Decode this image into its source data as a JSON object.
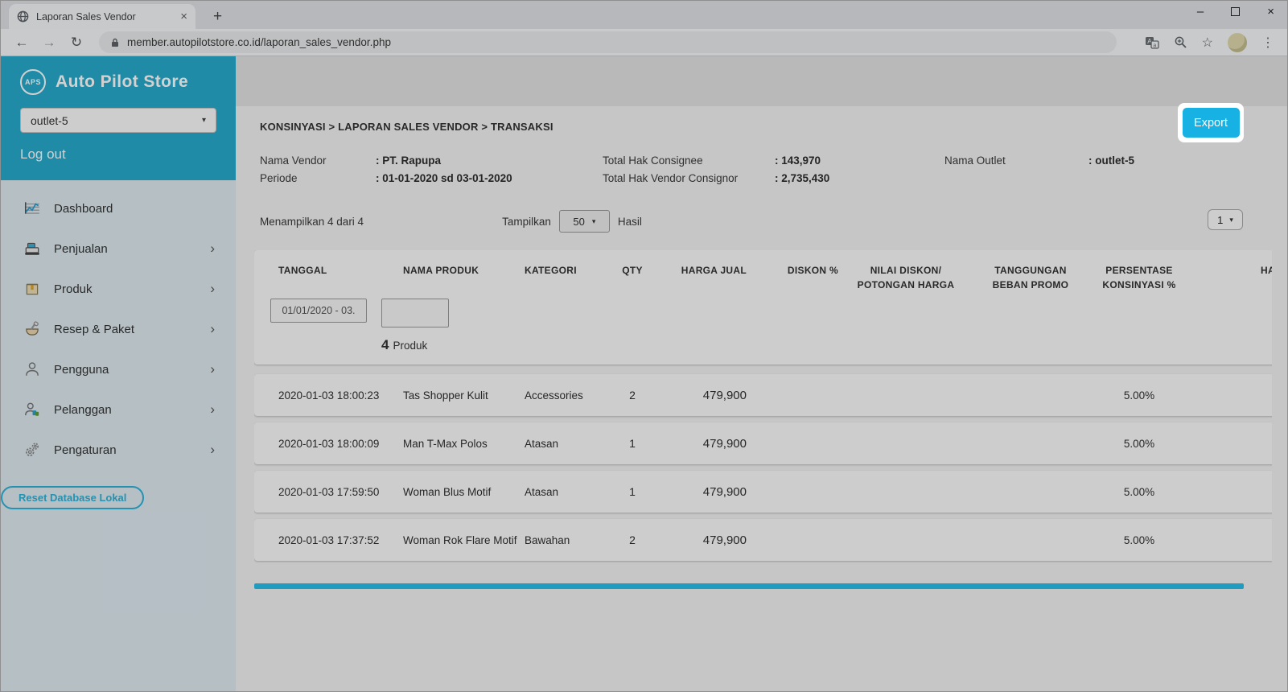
{
  "browser": {
    "tab_title": "Laporan Sales Vendor",
    "url": "member.autopilotstore.co.id/laporan_sales_vendor.php"
  },
  "icons": {
    "back": "←",
    "forward": "→",
    "reload": "↻",
    "star": "☆",
    "dots": "⋮",
    "new_tab": "+",
    "tab_close": "×",
    "minimize": "–",
    "close": "×",
    "caret_down": "▾",
    "chevron_right": "›"
  },
  "sidebar": {
    "logo_text": "APS",
    "brand": "Auto Pilot Store",
    "outlet_selector": "outlet-5",
    "logout_label": "Log out",
    "menu": [
      {
        "label": "Dashboard",
        "icon": "dashboard-icon",
        "has_submenu": false
      },
      {
        "label": "Penjualan",
        "icon": "sales-icon",
        "has_submenu": true
      },
      {
        "label": "Produk",
        "icon": "product-icon",
        "has_submenu": true
      },
      {
        "label": "Resep & Paket",
        "icon": "recipe-icon",
        "has_submenu": true
      },
      {
        "label": "Pengguna",
        "icon": "users-icon",
        "has_submenu": true
      },
      {
        "label": "Pelanggan",
        "icon": "customers-icon",
        "has_submenu": true
      },
      {
        "label": "Pengaturan",
        "icon": "settings-icon",
        "has_submenu": true
      }
    ],
    "reset_button": "Reset Database Lokal"
  },
  "main": {
    "breadcrumb": "KONSINYASI > LAPORAN SALES VENDOR  > TRANSAKSI",
    "info": {
      "nama_vendor_label": "Nama Vendor",
      "nama_vendor_value": ": PT. Rapupa",
      "periode_label": "Periode",
      "periode_value": ": 01-01-2020 sd 03-01-2020",
      "total_consignee_label": "Total Hak Consignee",
      "total_consignee_value": ": 143,970",
      "total_consignor_label": "Total Hak Vendor Consignor",
      "total_consignor_value": ": 2,735,430",
      "nama_outlet_label": "Nama Outlet",
      "nama_outlet_value": ": outlet-5"
    },
    "export_label": "Export",
    "showing_text": "Menampilkan 4 dari 4",
    "show_label": "Tampilkan",
    "page_size": "50",
    "results_label": "Hasil",
    "page_number": "1",
    "table": {
      "headers": [
        "TANGGAL",
        "NAMA PRODUK",
        "KATEGORI",
        "QTY",
        "HARGA JUAL",
        "DISKON %",
        "NILAI DISKON/\nPOTONGAN HARGA",
        "TANGGUNGAN\nBEBAN PROMO",
        "PERSENTASE\nKONSINYASI %",
        "HA"
      ],
      "date_filter": "01/01/2020 - 03.",
      "product_filter": "",
      "product_count": "4",
      "product_count_label": "Produk",
      "rows": [
        {
          "tanggal": "2020-01-03 18:00:23",
          "nama_produk": "Tas Shopper Kulit",
          "kategori": "Accessories",
          "qty": "2",
          "harga_jual": "479,900",
          "diskon": "",
          "nilai_diskon": "",
          "tanggungan": "",
          "persentase": "5.00%",
          "ha": ""
        },
        {
          "tanggal": "2020-01-03 18:00:09",
          "nama_produk": "Man T-Max Polos",
          "kategori": "Atasan",
          "qty": "1",
          "harga_jual": "479,900",
          "diskon": "",
          "nilai_diskon": "",
          "tanggungan": "",
          "persentase": "5.00%",
          "ha": ""
        },
        {
          "tanggal": "2020-01-03 17:59:50",
          "nama_produk": "Woman Blus Motif",
          "kategori": "Atasan",
          "qty": "1",
          "harga_jual": "479,900",
          "diskon": "",
          "nilai_diskon": "",
          "tanggungan": "",
          "persentase": "5.00%",
          "ha": ""
        },
        {
          "tanggal": "2020-01-03 17:37:52",
          "nama_produk": "Woman Rok Flare Motif",
          "kategori": "Bawahan",
          "qty": "2",
          "harga_jual": "479,900",
          "diskon": "",
          "nilai_diskon": "",
          "tanggungan": "",
          "persentase": "5.00%",
          "ha": ""
        }
      ]
    }
  },
  "colors": {
    "accent": "#17b1e3",
    "sidebar_teal": "#27aacb",
    "scrollbar": "#26bfe9"
  }
}
